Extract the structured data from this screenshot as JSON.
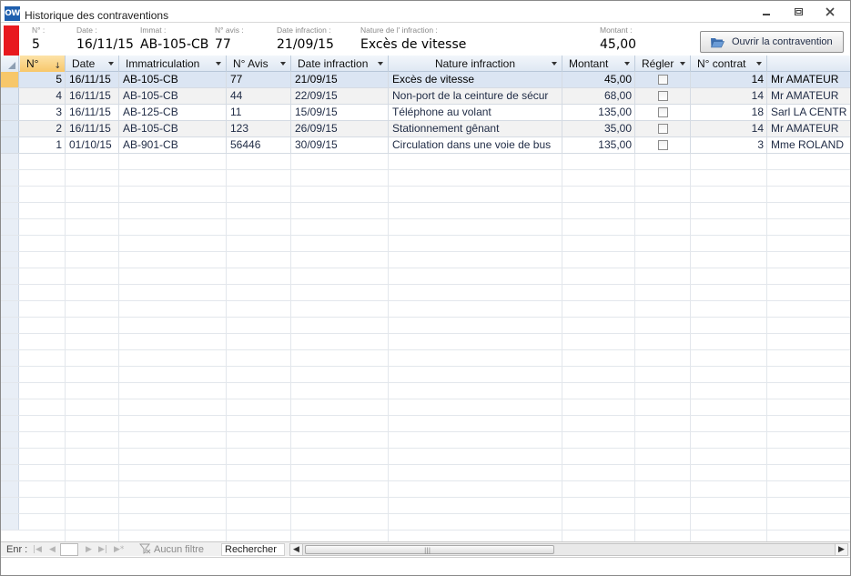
{
  "window": {
    "title": "Historique des contraventions",
    "app_icon_text": "OW",
    "minimize_glyph": "▭",
    "maximize_glyph": "▣",
    "close_glyph": "✕"
  },
  "header": {
    "fields": [
      {
        "label": "N° :",
        "value": "5"
      },
      {
        "label": "Date :",
        "value": "16/11/15"
      },
      {
        "label": "Immat :",
        "value": "AB-105-CB"
      },
      {
        "label": "N° avis :",
        "value": "77"
      },
      {
        "label": "Date infraction :",
        "value": "21/09/15"
      },
      {
        "label": "Nature de l' infraction :",
        "value": "Excès de vitesse"
      },
      {
        "label": "Montant :",
        "value": "45,00"
      }
    ],
    "open_button_label": "Ouvrir la contravention",
    "marker_color": "#e8191f"
  },
  "grid": {
    "columns": [
      "N°",
      "Date",
      "Immatriculation",
      "N° Avis",
      "Date infraction",
      "Nature infraction",
      "Montant",
      "Régler",
      "N° contrat",
      ""
    ],
    "sort_icon": "↓",
    "rows": [
      {
        "num": "5",
        "date": "16/11/15",
        "immat": "AB-105-CB",
        "avis": "77",
        "date_inf": "21/09/15",
        "nature": "Excès de vitesse",
        "montant": "45,00",
        "regler": false,
        "contrat": "14",
        "client": "Mr AMATEUR"
      },
      {
        "num": "4",
        "date": "16/11/15",
        "immat": "AB-105-CB",
        "avis": "44",
        "date_inf": "22/09/15",
        "nature": "Non-port de la ceinture de sécur",
        "montant": "68,00",
        "regler": false,
        "contrat": "14",
        "client": "Mr AMATEUR"
      },
      {
        "num": "3",
        "date": "16/11/15",
        "immat": "AB-125-CB",
        "avis": "11",
        "date_inf": "15/09/15",
        "nature": "Téléphone au volant",
        "montant": "135,00",
        "regler": false,
        "contrat": "18",
        "client": "Sarl LA CENTR"
      },
      {
        "num": "2",
        "date": "16/11/15",
        "immat": "AB-105-CB",
        "avis": "123",
        "date_inf": "26/09/15",
        "nature": "Stationnement gênant",
        "montant": "35,00",
        "regler": false,
        "contrat": "14",
        "client": "Mr AMATEUR"
      },
      {
        "num": "1",
        "date": "01/10/15",
        "immat": "AB-901-CB",
        "avis": "56446",
        "date_inf": "30/09/15",
        "nature": "Circulation dans une voie de bus",
        "montant": "135,00",
        "regler": false,
        "contrat": "3",
        "client": "Mme ROLAND"
      }
    ],
    "current_row_index": 0
  },
  "navigation": {
    "record_label": "Enr :",
    "first_glyph": "|◀",
    "prev_glyph": "◀",
    "next_glyph": "▶",
    "last_glyph": "▶|",
    "new_glyph": "▶*",
    "filter_label": "Aucun filtre",
    "search_label": "Rechercher",
    "scroll_left_glyph": "◀",
    "scroll_right_glyph": "▶",
    "scroll_grip": "|||"
  }
}
